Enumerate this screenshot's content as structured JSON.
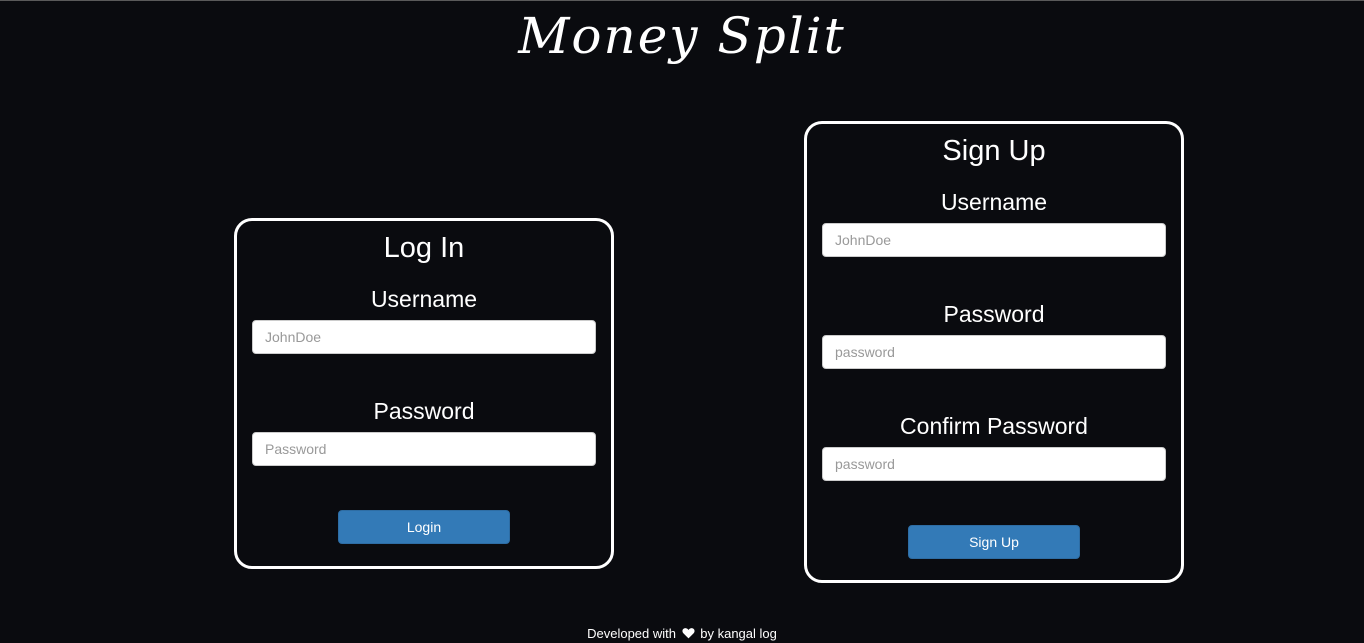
{
  "app": {
    "title": "Money Split"
  },
  "login": {
    "heading": "Log In",
    "username_label": "Username",
    "username_placeholder": "JohnDoe",
    "password_label": "Password",
    "password_placeholder": "Password",
    "submit_label": "Login"
  },
  "signup": {
    "heading": "Sign Up",
    "username_label": "Username",
    "username_placeholder": "JohnDoe",
    "password_label": "Password",
    "password_placeholder": "password",
    "confirm_label": "Confirm Password",
    "confirm_placeholder": "password",
    "submit_label": "Sign Up"
  },
  "footer": {
    "prefix": "Developed with",
    "icon": "heart-icon",
    "suffix": "by kangal log"
  },
  "colors": {
    "background": "#0a0b0f",
    "button": "#337ab7",
    "text": "#ffffff"
  }
}
